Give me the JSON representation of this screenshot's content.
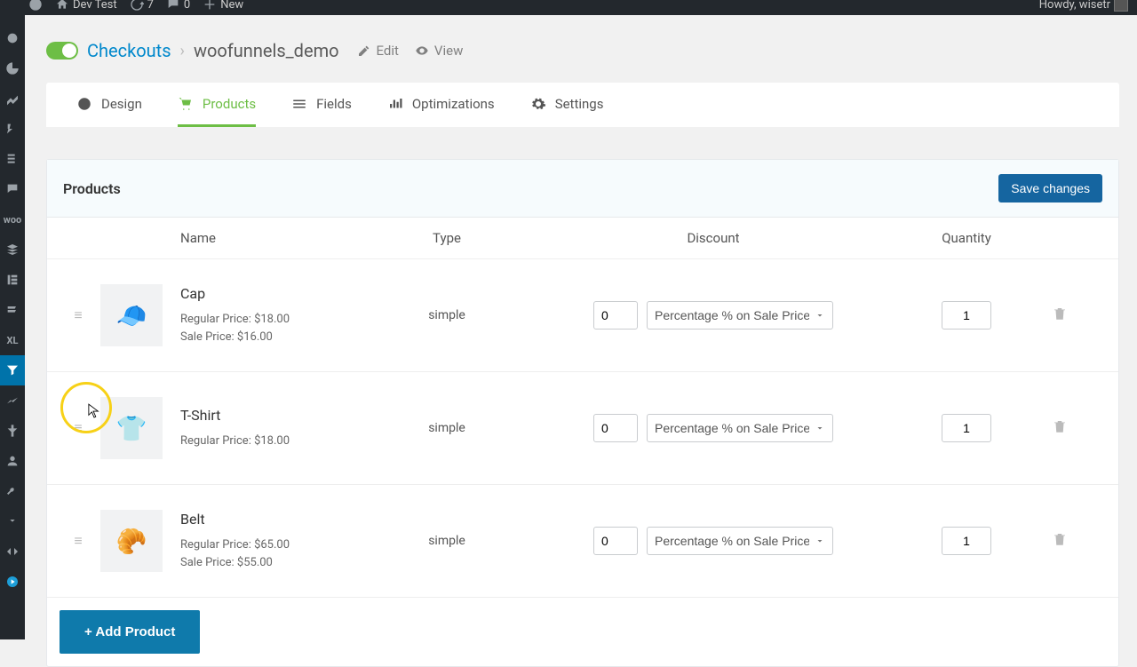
{
  "admin_bar": {
    "site_name": "Dev Test",
    "updates": "7",
    "comments": "0",
    "new": "New",
    "howdy": "Howdy, wisetr"
  },
  "header": {
    "breadcrumb_root": "Checkouts",
    "page_name": "woofunnels_demo",
    "edit_label": "Edit",
    "view_label": "View"
  },
  "tabs": {
    "design": "Design",
    "products": "Products",
    "fields": "Fields",
    "optimizations": "Optimizations",
    "settings": "Settings"
  },
  "card": {
    "title": "Products",
    "save_btn": "Save changes",
    "columns": {
      "name": "Name",
      "type": "Type",
      "discount": "Discount",
      "quantity": "Quantity"
    },
    "discount_option": "Percentage % on Sale Price",
    "rows": [
      {
        "name": "Cap",
        "regular": "Regular Price: $18.00",
        "sale": "Sale Price: $16.00",
        "type": "simple",
        "discount_value": "0",
        "quantity": "1"
      },
      {
        "name": "T-Shirt",
        "regular": "Regular Price: $18.00",
        "sale": "",
        "type": "simple",
        "discount_value": "0",
        "quantity": "1"
      },
      {
        "name": "Belt",
        "regular": "Regular Price: $65.00",
        "sale": "Sale Price: $55.00",
        "type": "simple",
        "discount_value": "0",
        "quantity": "1"
      }
    ],
    "add_product": "+ Add Product"
  },
  "sidebar_label_xl": "XL"
}
